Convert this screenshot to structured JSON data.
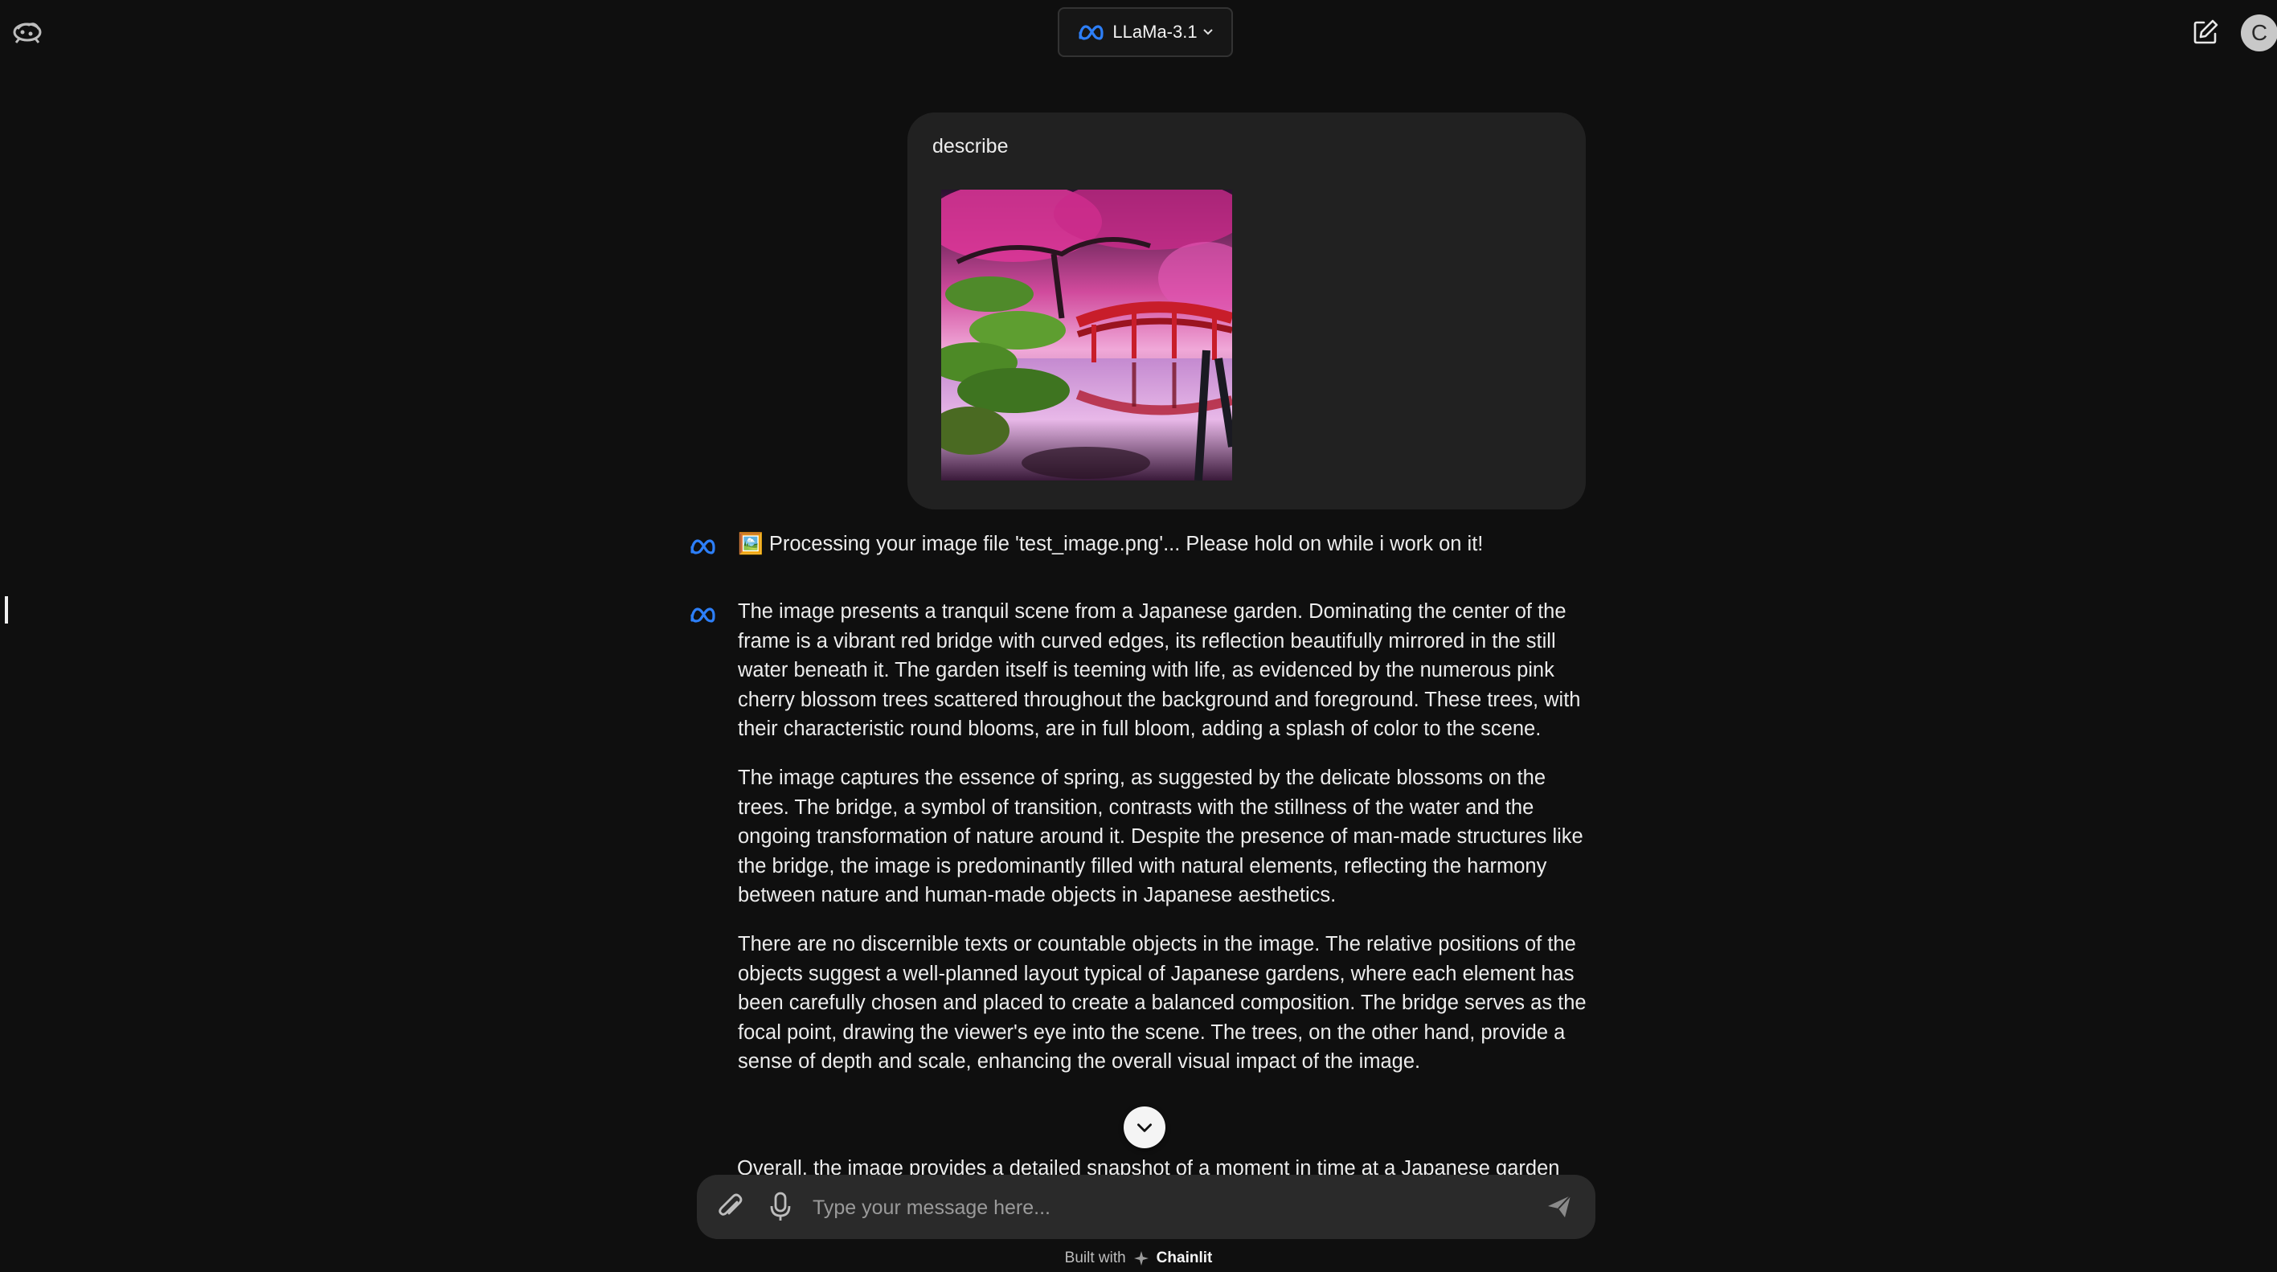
{
  "header": {
    "model_label": "LLaMa-3.1",
    "avatar_initial": "C"
  },
  "conversation": {
    "user_message": {
      "text": "describe"
    },
    "assistant_messages": [
      {
        "text": "🖼️ Processing your image file 'test_image.png'... Please hold on while i work on it!"
      },
      {
        "paragraphs": [
          "The image presents a tranquil scene from a Japanese garden. Dominating the center of the frame is a vibrant red bridge with curved edges, its reflection beautifully mirrored in the still water beneath it. The garden itself is teeming with life, as evidenced by the numerous pink cherry blossom trees scattered throughout the background and foreground. These trees, with their characteristic round blooms, are in full bloom, adding a splash of color to the scene.",
          "The image captures the essence of spring, as suggested by the delicate blossoms on the trees. The bridge, a symbol of transition, contrasts with the stillness of the water and the ongoing transformation of nature around it. Despite the presence of man-made structures like the bridge, the image is predominantly filled with natural elements, reflecting the harmony between nature and human-made objects in Japanese aesthetics.",
          "There are no discernible texts or countable objects in the image. The relative positions of the objects suggest a well-planned layout typical of Japanese gardens, where each element has been carefully chosen and placed to create a balanced composition. The bridge serves as the focal point, drawing the viewer's eye into the scene. The trees, on the other hand, provide a sense of depth and scale, enhancing the overall visual impact of the image.",
          "Overall, the image provides a detailed snapshot of a moment in time at a Japanese garden"
        ]
      }
    ]
  },
  "composer": {
    "placeholder": "Type your message here..."
  },
  "footer": {
    "built_with": "Built with",
    "brand": "Chainlit"
  },
  "colors": {
    "background": "#0f0f0f",
    "bubble": "#212121",
    "composer": "#2a2a2a",
    "meta_blue": "#2d7ff9",
    "text": "#ececec"
  }
}
